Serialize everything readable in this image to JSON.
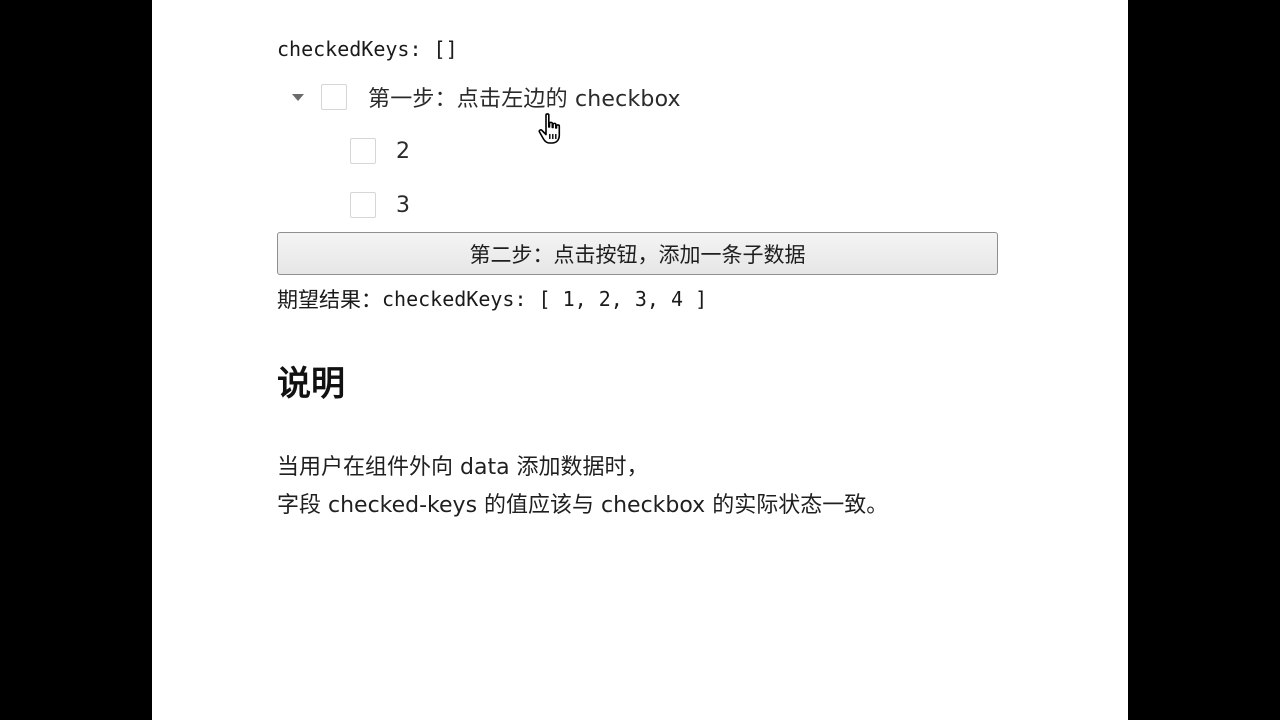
{
  "demo": {
    "checked_keys_text": "checkedKeys: []",
    "tree": {
      "root": {
        "label": "第一步：点击左边的 checkbox",
        "expanded": true,
        "checked": false
      },
      "children": [
        {
          "label": "2",
          "checked": false
        },
        {
          "label": "3",
          "checked": false
        }
      ]
    },
    "add_button_label": "第二步：点击按钮，添加一条子数据",
    "expected_prefix": "期望结果：",
    "expected_code": "checkedKeys: [ 1, 2, 3, 4 ]"
  },
  "description": {
    "heading": "说明",
    "line1": "当用户在组件外向 data 添加数据时，",
    "line2": "字段 checked-keys 的值应该与 checkbox 的实际状态一致。"
  },
  "colors": {
    "page_background": "#ffffff",
    "outer_background": "#000000",
    "checkbox_border": "#d6d6d6",
    "button_border": "#8f8f8f"
  },
  "icons": {
    "expand": "caret-down-icon",
    "pointer": "hand-pointer-cursor"
  }
}
